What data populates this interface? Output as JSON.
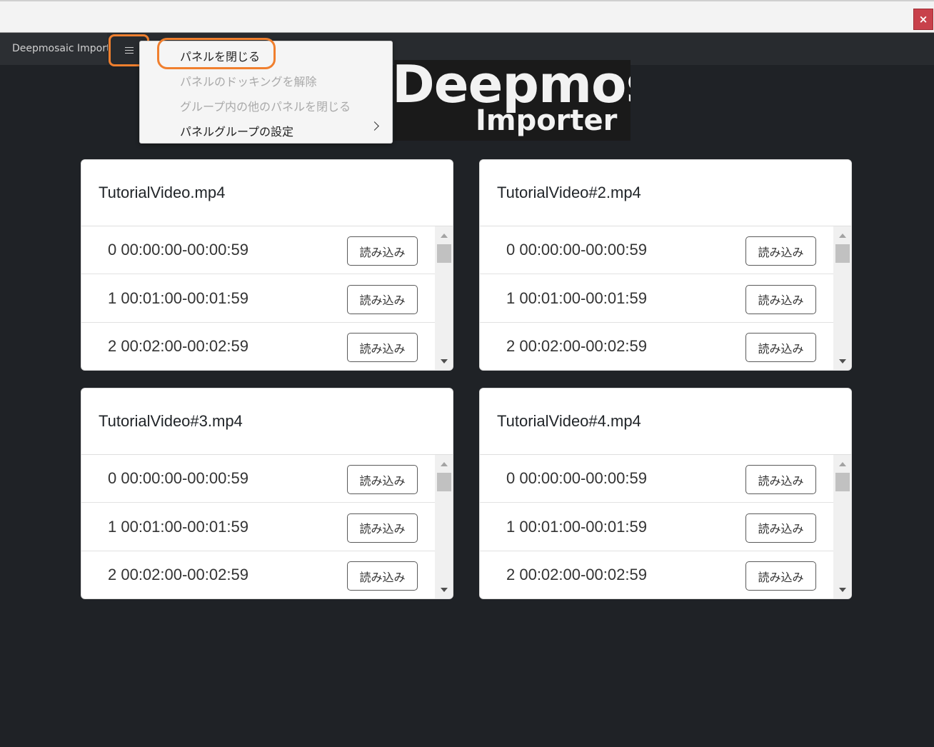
{
  "window": {
    "close_glyph": "×"
  },
  "panel": {
    "tab_label": "Deepmosaic Importer",
    "menu_icon": "hamburger-icon"
  },
  "context_menu": {
    "items": [
      {
        "label": "パネルを閉じる",
        "enabled": true
      },
      {
        "label": "パネルのドッキングを解除",
        "enabled": false
      },
      {
        "label": "グループ内の他のパネルを閉じる",
        "enabled": false
      },
      {
        "label": "パネルグループの設定",
        "enabled": true,
        "has_submenu": true
      }
    ]
  },
  "logo": {
    "line1": "Deepmosaic",
    "line2": "Importer"
  },
  "cards": [
    {
      "title": "TutorialVideo.mp4",
      "rows": [
        {
          "label": "0 00:00:00-00:00:59",
          "button": "読み込み"
        },
        {
          "label": "1 00:01:00-00:01:59",
          "button": "読み込み"
        },
        {
          "label": "2 00:02:00-00:02:59",
          "button": "読み込み"
        }
      ]
    },
    {
      "title": "TutorialVideo#2.mp4",
      "rows": [
        {
          "label": "0 00:00:00-00:00:59",
          "button": "読み込み"
        },
        {
          "label": "1 00:01:00-00:01:59",
          "button": "読み込み"
        },
        {
          "label": "2 00:02:00-00:02:59",
          "button": "読み込み"
        }
      ]
    },
    {
      "title": "TutorialVideo#3.mp4",
      "rows": [
        {
          "label": "0 00:00:00-00:00:59",
          "button": "読み込み"
        },
        {
          "label": "1 00:01:00-00:01:59",
          "button": "読み込み"
        },
        {
          "label": "2 00:02:00-00:02:59",
          "button": "読み込み"
        }
      ]
    },
    {
      "title": "TutorialVideo#4.mp4",
      "rows": [
        {
          "label": "0 00:00:00-00:00:59",
          "button": "読み込み"
        },
        {
          "label": "1 00:01:00-00:01:59",
          "button": "読み込み"
        },
        {
          "label": "2 00:02:00-00:02:59",
          "button": "読み込み"
        }
      ]
    }
  ],
  "colors": {
    "background": "#1f2226",
    "highlight": "#f07f2e",
    "close": "#c8414b"
  }
}
